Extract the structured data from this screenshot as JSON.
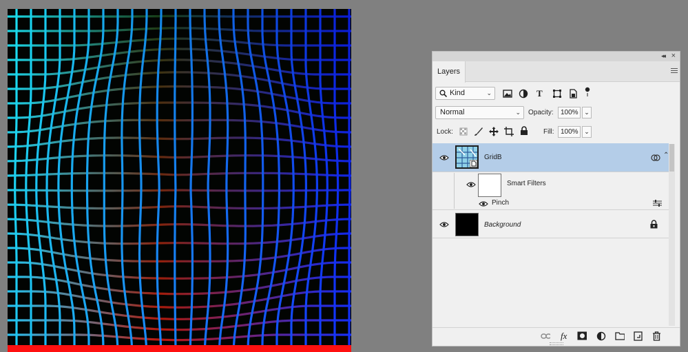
{
  "canvas": {
    "grid_colors": {
      "top_left": "#1ae0ef",
      "top_right": "#0a1bd8",
      "bottom_left": "#ff1212",
      "bottom_right": "#1230ff",
      "background": "#020402"
    }
  },
  "panel": {
    "collapse_glyph": "◂◂",
    "close_glyph": "×",
    "tab_label": "Layers",
    "filter": {
      "kind_label": "Kind",
      "icons": [
        "pixel-filter-icon",
        "adjustment-filter-icon",
        "type-filter-icon",
        "shape-filter-icon",
        "smart-object-filter-icon",
        "filter-toggle-icon"
      ]
    },
    "blend_mode": "Normal",
    "opacity_label": "Opacity:",
    "opacity_value": "100%",
    "lock_label": "Lock:",
    "fill_label": "Fill:",
    "fill_value": "100%",
    "layers": [
      {
        "name": "GridB",
        "selected": true,
        "type": "smart-object"
      },
      {
        "name": "Smart Filters",
        "type": "smart-filters"
      },
      {
        "name": "Pinch",
        "type": "filter"
      },
      {
        "name": "Background",
        "type": "background",
        "locked": true
      }
    ],
    "footer_icons": [
      "link-layers-icon",
      "fx-icon",
      "add-mask-icon",
      "adjustment-layer-icon",
      "new-group-icon",
      "new-layer-icon",
      "delete-icon"
    ],
    "footer_fx": "fx",
    "type_glyph": "T"
  }
}
